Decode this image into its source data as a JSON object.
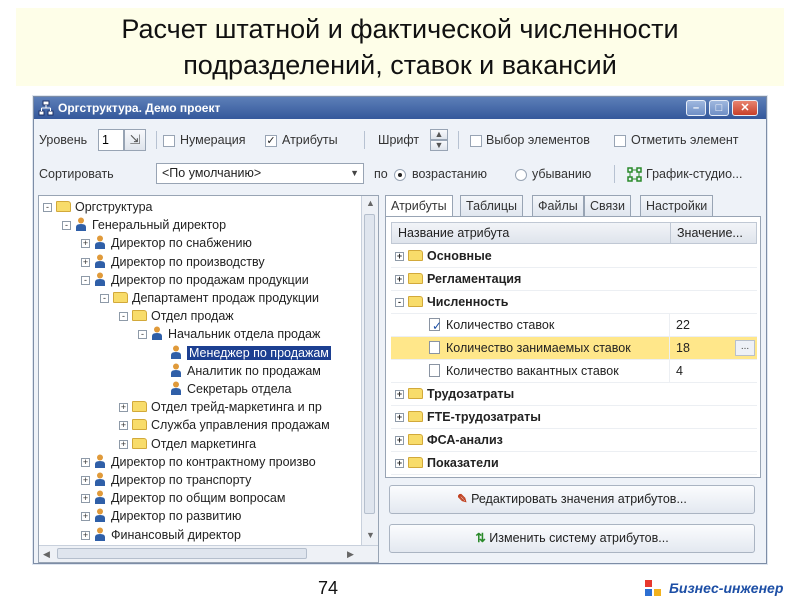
{
  "slide": {
    "title_line1": "Расчет штатной и фактической численности",
    "title_line2": "подразделений, ставок и вакансий",
    "page_number": "74",
    "brand": "Бизнес-инженер"
  },
  "window": {
    "title": "Оргструктура. Демо проект",
    "buttons": {
      "minimize": "–",
      "maximize": "□",
      "close": "✕"
    }
  },
  "toolbar": {
    "level_label": "Уровень",
    "level_value": "1",
    "numbering_label": "Нумерация",
    "numbering_checked": false,
    "attributes_label": "Атрибуты",
    "attributes_checked": true,
    "font_label": "Шрифт",
    "select_elements_label": "Выбор элементов",
    "mark_element_label": "Отметить элемент",
    "sort_label": "Сортировать",
    "sort_value": "<По умолчанию>",
    "by_label": "по",
    "ascending_label": "возрастанию",
    "descending_label": "убыванию",
    "sort_order": "ascending",
    "chart_studio_label": "График-студио..."
  },
  "tree": {
    "items": [
      {
        "label": "Оргструктура",
        "icon": "folder-icon",
        "expander": "-",
        "level": 0
      },
      {
        "label": "Генеральный директор",
        "icon": "person-icon",
        "expander": "-",
        "level": 1
      },
      {
        "label": "Директор по снабжению",
        "icon": "person-icon",
        "expander": "+",
        "level": 2
      },
      {
        "label": "Директор по производству",
        "icon": "person-icon",
        "expander": "+",
        "level": 2
      },
      {
        "label": "Директор по продажам продукции",
        "icon": "person-icon",
        "expander": "-",
        "level": 2
      },
      {
        "label": "Департамент продаж продукции",
        "icon": "folder-icon",
        "expander": "-",
        "level": 3
      },
      {
        "label": "Отдел продаж",
        "icon": "folder-icon",
        "expander": "-",
        "level": 4
      },
      {
        "label": "Начальник отдела продаж",
        "icon": "person-icon",
        "expander": "-",
        "level": 5
      },
      {
        "label": "Менеджер по продажам",
        "icon": "person-icon",
        "expander": "",
        "level": 6,
        "selected": true
      },
      {
        "label": "Аналитик по продажам",
        "icon": "person-icon",
        "expander": "",
        "level": 6
      },
      {
        "label": "Секретарь отдела",
        "icon": "person-icon",
        "expander": "",
        "level": 6
      },
      {
        "label": "Отдел трейд-маркетинга и пр",
        "icon": "folder-icon",
        "expander": "+",
        "level": 4
      },
      {
        "label": "Служба управления продажам",
        "icon": "folder-icon",
        "expander": "+",
        "level": 4
      },
      {
        "label": "Отдел маркетинга",
        "icon": "folder-icon",
        "expander": "+",
        "level": 4
      },
      {
        "label": "Директор по контрактному произво",
        "icon": "person-icon",
        "expander": "+",
        "level": 2
      },
      {
        "label": "Директор по транспорту",
        "icon": "person-icon",
        "expander": "+",
        "level": 2
      },
      {
        "label": "Директор по общим вопросам",
        "icon": "person-icon",
        "expander": "+",
        "level": 2
      },
      {
        "label": "Директор по развитию",
        "icon": "person-icon",
        "expander": "+",
        "level": 2
      },
      {
        "label": "Финансовый директор",
        "icon": "person-icon",
        "expander": "+",
        "level": 2
      }
    ]
  },
  "tabs": [
    "Атрибуты",
    "Таблицы",
    "Файлы",
    "Связи",
    "Настройки"
  ],
  "active_tab": "Атрибуты",
  "grid": {
    "col_name": "Название атрибута",
    "col_value": "Значение...",
    "rows": [
      {
        "label": "Основные",
        "type": "group",
        "expander": "+"
      },
      {
        "label": "Регламентация",
        "type": "group",
        "expander": "+"
      },
      {
        "label": "Численность",
        "type": "group",
        "expander": "-"
      },
      {
        "label": "Количество ставок",
        "type": "item",
        "value": "22",
        "icon": "edit-doc-icon"
      },
      {
        "label": "Количество занимаемых ставок",
        "type": "item",
        "value": "18",
        "icon": "doc-icon",
        "highlighted": true,
        "ellipsis": "..."
      },
      {
        "label": "Количество вакантных ставок",
        "type": "item",
        "value": "4",
        "icon": "doc-icon"
      },
      {
        "label": "Трудозатраты",
        "type": "group",
        "expander": "+"
      },
      {
        "label": "FTE-трудозатраты",
        "type": "group",
        "expander": "+"
      },
      {
        "label": "ФСА-анализ",
        "type": "group",
        "expander": "+"
      },
      {
        "label": "Показатели",
        "type": "group",
        "expander": "+"
      }
    ]
  },
  "actions": {
    "edit_values": "Редактировать значения атрибутов...",
    "change_system": "Изменить систему атрибутов..."
  },
  "colors": {
    "selection": "#1c3f91",
    "highlight_row": "#ffe78a",
    "titlebar": "#34589b",
    "brand": "#1d4fa6"
  }
}
